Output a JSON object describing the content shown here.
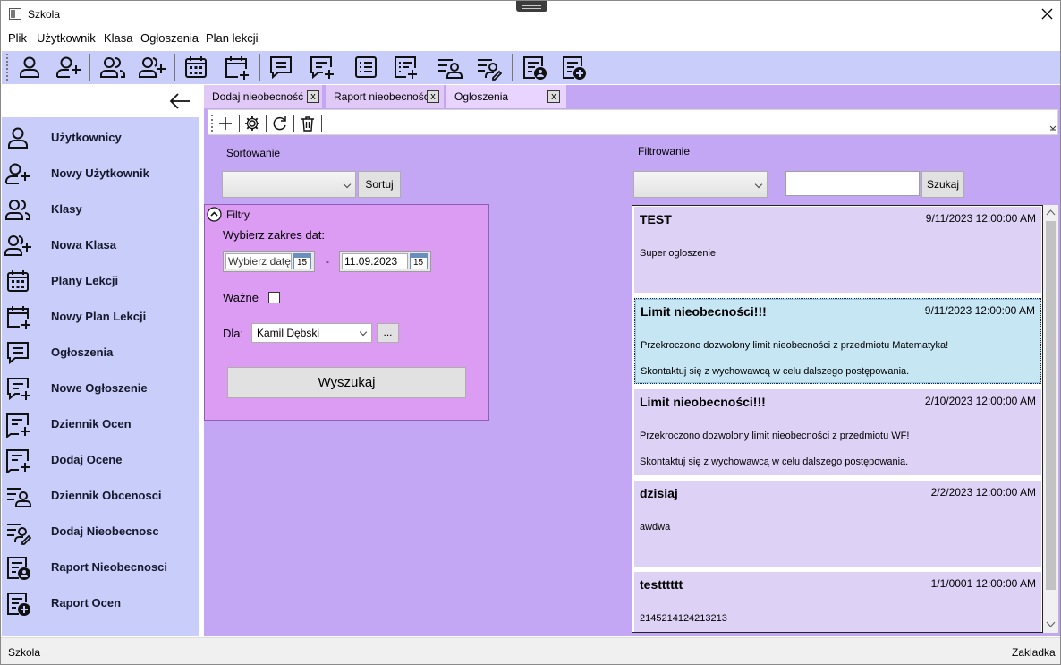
{
  "window": {
    "title": "Szkola"
  },
  "menu": [
    "Plik",
    "Użytkownik",
    "Klasa",
    "Ogłoszenia",
    "Plan lekcji"
  ],
  "toolbar": {
    "icons": [
      "user-icon",
      "add-user-icon",
      "users-icon",
      "add-users-icon",
      "calendar-icon",
      "add-calendar-icon",
      "message-icon",
      "add-message-icon",
      "list-icon",
      "add-list-icon",
      "attendance-icon",
      "add-attendance-icon",
      "attendance-report-icon",
      "grades-report-icon"
    ]
  },
  "sidebar": {
    "items": [
      {
        "label": "Użytkownicy",
        "icon": "user-icon"
      },
      {
        "label": "Nowy Użytkownik",
        "icon": "add-user-icon"
      },
      {
        "label": "Klasy",
        "icon": "users-icon"
      },
      {
        "label": "Nowa Klasa",
        "icon": "add-users-icon"
      },
      {
        "label": "Plany Lekcji",
        "icon": "calendar-icon"
      },
      {
        "label": "Nowy Plan Lekcji",
        "icon": "add-calendar-icon"
      },
      {
        "label": "Ogłoszenia",
        "icon": "message-icon"
      },
      {
        "label": "Nowe Ogłoszenie",
        "icon": "add-message-icon"
      },
      {
        "label": "Dziennik Ocen",
        "icon": "add-grade-icon"
      },
      {
        "label": "Dodaj Ocene",
        "icon": "add-grade-icon"
      },
      {
        "label": "Dziennik Obcenosci",
        "icon": "attendance-icon"
      },
      {
        "label": "Dodaj Nieobecnosc",
        "icon": "add-attendance-icon"
      },
      {
        "label": "Raport Nieobecnosci",
        "icon": "attendance-report-icon"
      },
      {
        "label": "Raport Ocen",
        "icon": "grades-report-icon"
      }
    ]
  },
  "tabs": [
    {
      "label": "Dodaj nieobecność",
      "close": "x"
    },
    {
      "label": "Raport nieobecności",
      "close": "x"
    },
    {
      "label": "Ogloszenia",
      "close": "x"
    }
  ],
  "sorting": {
    "label": "Sortowanie",
    "selected": "",
    "button": "Sortuj"
  },
  "filtering": {
    "label": "Filtrowanie",
    "selected": "",
    "search_value": "",
    "button": "Szukaj"
  },
  "filters": {
    "header": "Filtry",
    "date_range_label": "Wybierz zakres dat:",
    "date_from_placeholder": "Wybierz datę",
    "date_separator": "-",
    "date_to": "11.09.2023",
    "calendar_day": "15",
    "important_label": "Ważne",
    "important_checked": false,
    "for_label": "Dla:",
    "for_selected": "Kamil Dębski",
    "more_button": "...",
    "search_button": "Wyszukaj"
  },
  "announcements": [
    {
      "title": "TEST",
      "date": "9/11/2023 12:00:00 AM",
      "body": "Super ogloszenie",
      "selected": false
    },
    {
      "title": "Limit nieobecności!!!",
      "date": "9/11/2023 12:00:00 AM",
      "body": "Przekroczono dozwolony limit nieobecności z przedmiotu Matematyka!\nSkontaktuj się z wychowawcą w celu dalszego postępowania.",
      "selected": true
    },
    {
      "title": "Limit nieobecności!!!",
      "date": "2/10/2023 12:00:00 AM",
      "body": "Przekroczono dozwolony limit nieobecności z przedmiotu WF!\nSkontaktuj się z wychowawcą w celu dalszego postępowania.",
      "selected": false
    },
    {
      "title": "dzisiaj",
      "date": "2/2/2023 12:00:00 AM",
      "body": "awdwa",
      "selected": false
    },
    {
      "title": "testttttt",
      "date": "1/1/0001 12:00:00 AM",
      "body": "2145214124213213",
      "selected": false
    }
  ],
  "status": {
    "left": "Szkola",
    "right": "Zakladka"
  }
}
